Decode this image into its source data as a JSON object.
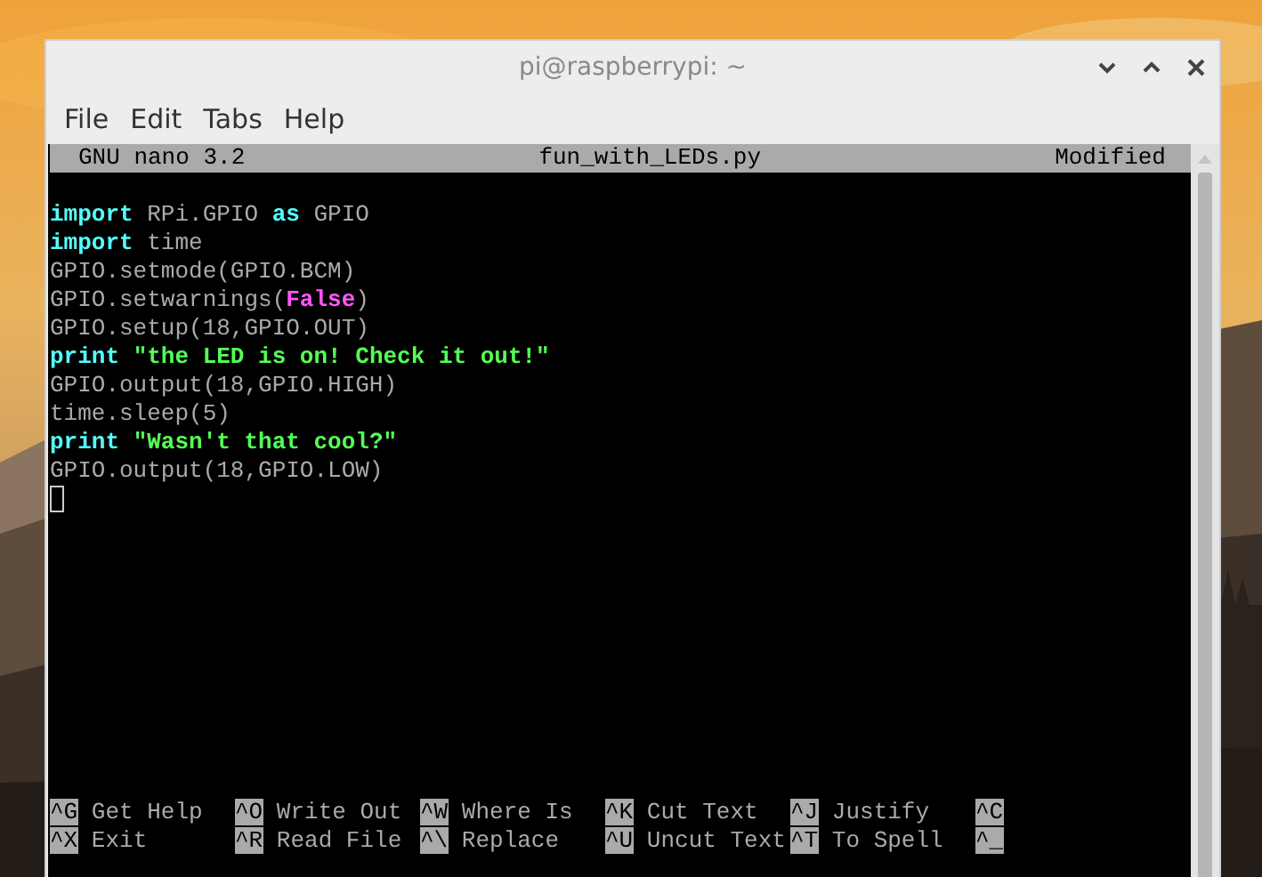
{
  "window": {
    "title": "pi@raspberrypi: ~"
  },
  "menu": [
    "File",
    "Edit",
    "Tabs",
    "Help"
  ],
  "nano": {
    "version": "GNU nano 3.2",
    "filename": "fun_with_LEDs.py",
    "status": "Modified"
  },
  "code_lines": [
    [
      {
        "kind": "keyword",
        "text": "import"
      },
      {
        "kind": "plain",
        "text": " RPi.GPIO "
      },
      {
        "kind": "keyword",
        "text": "as"
      },
      {
        "kind": "plain",
        "text": " GPIO"
      }
    ],
    [
      {
        "kind": "keyword",
        "text": "import"
      },
      {
        "kind": "plain",
        "text": " time"
      }
    ],
    [
      {
        "kind": "plain",
        "text": "GPIO.setmode(GPIO.BCM)"
      }
    ],
    [
      {
        "kind": "plain",
        "text": "GPIO.setwarnings("
      },
      {
        "kind": "constant",
        "text": "False"
      },
      {
        "kind": "plain",
        "text": ")"
      }
    ],
    [
      {
        "kind": "plain",
        "text": "GPIO.setup(18,GPIO.OUT)"
      }
    ],
    [
      {
        "kind": "keyword",
        "text": "print"
      },
      {
        "kind": "string",
        "text": " \"the LED is on! Check it out!\""
      }
    ],
    [
      {
        "kind": "plain",
        "text": "GPIO.output(18,GPIO.HIGH)"
      }
    ],
    [
      {
        "kind": "plain",
        "text": "time.sleep(5)"
      }
    ],
    [
      {
        "kind": "keyword",
        "text": "print"
      },
      {
        "kind": "string",
        "text": " \"Wasn't that cool?\""
      }
    ],
    [
      {
        "kind": "plain",
        "text": "GPIO.output(18,GPIO.LOW)"
      }
    ]
  ],
  "shortcut_rows": [
    [
      {
        "key": "^G",
        "label": "Get Help"
      },
      {
        "key": "^O",
        "label": "Write Out"
      },
      {
        "key": "^W",
        "label": "Where Is"
      },
      {
        "key": "^K",
        "label": "Cut Text"
      },
      {
        "key": "^J",
        "label": "Justify"
      },
      {
        "key": "^C"
      }
    ],
    [
      {
        "key": "^X",
        "label": "Exit"
      },
      {
        "key": "^R",
        "label": "Read File"
      },
      {
        "key": "^\\",
        "label": "Replace"
      },
      {
        "key": "^U",
        "label": "Uncut Text"
      },
      {
        "key": "^T",
        "label": "To Spell"
      },
      {
        "key": "^_"
      }
    ]
  ]
}
